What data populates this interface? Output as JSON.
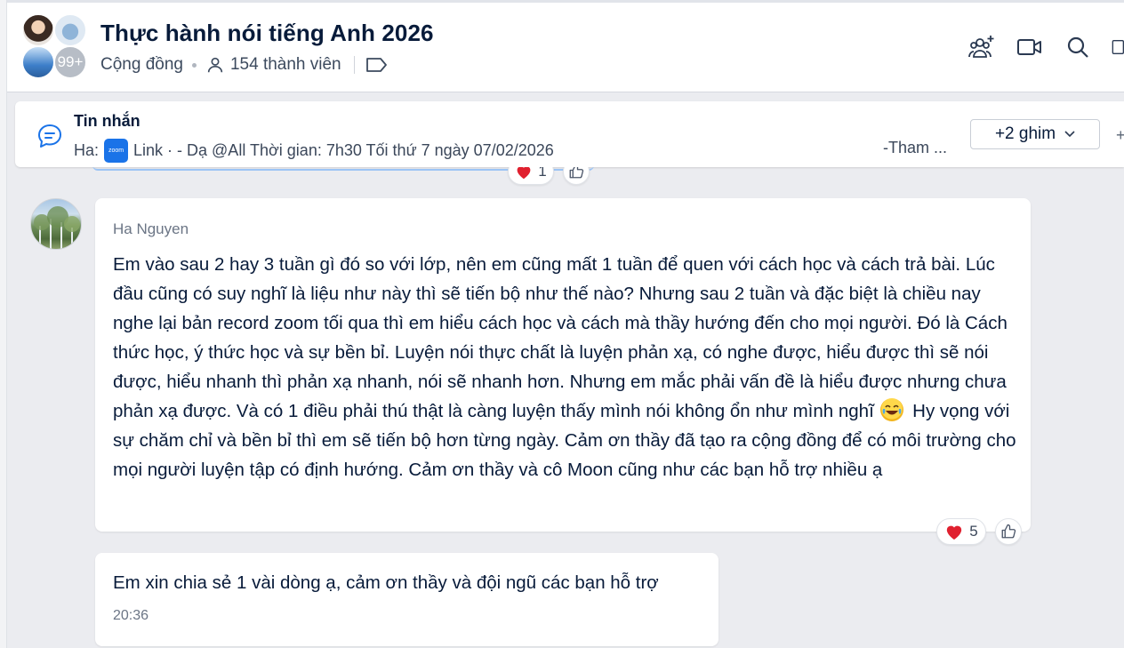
{
  "header": {
    "title": "Thực hành nói tiếng Anh 2026",
    "category": "Cộng đồng",
    "member_count": "154 thành viên",
    "avatar_overflow": "99+",
    "icons": [
      "add-member-icon",
      "video-call-icon",
      "search-icon",
      "layout-toggle-icon"
    ]
  },
  "pinned": {
    "title": "Tin nhắn",
    "sender_prefix": "Ha:",
    "zoom_label": "zoom",
    "line": "Link · - Dạ @All Thời gian: 7h30 Tối thứ 7 ngày 07/02/2026",
    "right_text": "-Tham ...",
    "more_button": "+2 ghim"
  },
  "top_reactions": {
    "heart_count": "1"
  },
  "messages": [
    {
      "sender": "Ha Nguyen",
      "text_part1": "Em vào sau 2 hay 3 tuần gì đó so với lớp, nên em cũng mất 1 tuần để quen với cách học và cách trả bài. Lúc đầu cũng có suy nghĩ là liệu như này thì sẽ tiến bộ như thế nào? Nhưng sau 2 tuần và đặc biệt là chiều nay nghe lại bản record zoom tối qua thì em hiểu cách học và cách mà thầy hướng đến cho mọi người. Đó là Cách thức học, ý thức học và sự bền bỉ. Luyện nói thực chất là luyện phản xạ, có nghe được, hiểu được thì sẽ nói được, hiểu nhanh thì phản xạ nhanh, nói sẽ nhanh hơn. Nhưng em mắc phải vấn đề là hiểu được nhưng chưa phản xạ được. Và có 1 điều phải thú thật là càng luyện thấy mình nói không ổn như mình nghĩ",
      "text_part2": "Hy vọng với sự chăm chỉ và bền bỉ thì em sẽ tiến bộ hơn từng ngày. Cảm ơn thầy đã tạo ra cộng đồng để có môi trường cho mọi người luyện tập có định hướng. Cảm ơn thầy và cô Moon cũng như các bạn hỗ trợ nhiều ạ",
      "heart_count": "5"
    },
    {
      "text": "Em xin chia sẻ 1 vài dòng ạ, cảm ơn thầy và đội ngũ các bạn hỗ trợ",
      "time": "20:36"
    }
  ],
  "colors": {
    "background": "#ebecf0",
    "bubble": "#ffffff",
    "heart": "#e0202f",
    "zoom_blue": "#1a73e8"
  }
}
